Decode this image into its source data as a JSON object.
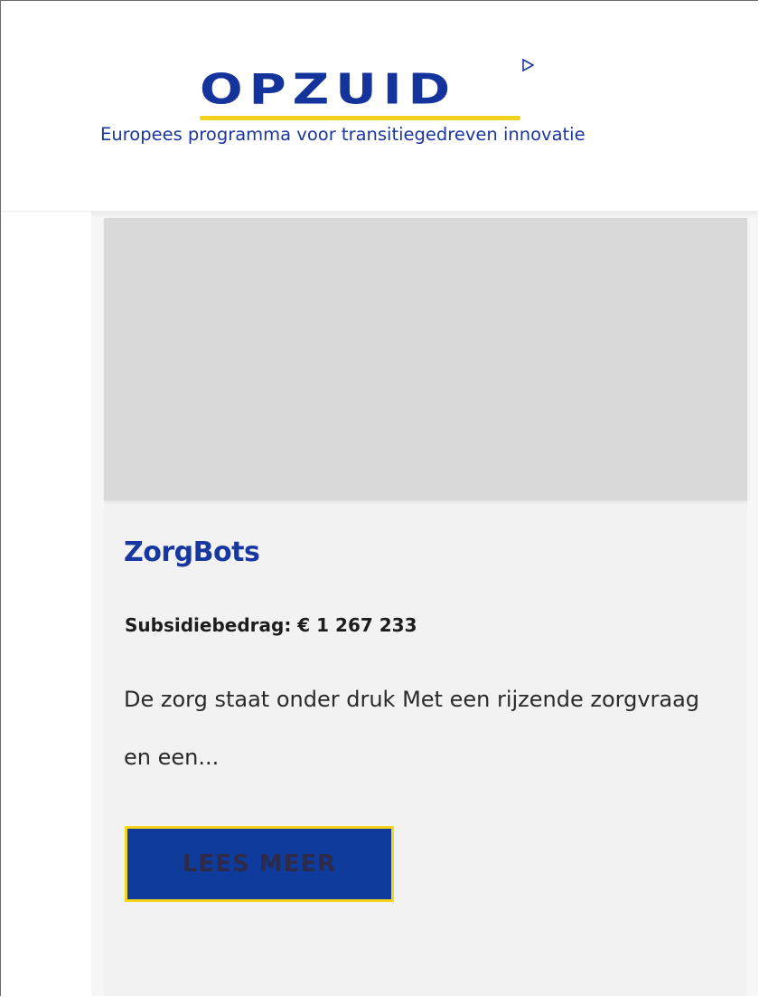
{
  "header": {
    "logo": {
      "wordmark": "OPZUID",
      "tagline": "Europees programma voor transitiegedreven innovatie",
      "play_icon": "play-triangle-icon"
    }
  },
  "card": {
    "title": "ZorgBots",
    "amount": "Subsidiebedrag: € 1 267 233",
    "excerpt": "De zorg staat onder druk Met een rijzende zorgvraag en een...",
    "button_label": "LEES MEER"
  },
  "colors": {
    "brand_blue": "#14349b",
    "brand_yellow": "#f2d21f",
    "button_blue": "#0f3b9c",
    "image_placeholder": "#d9d9d9"
  }
}
